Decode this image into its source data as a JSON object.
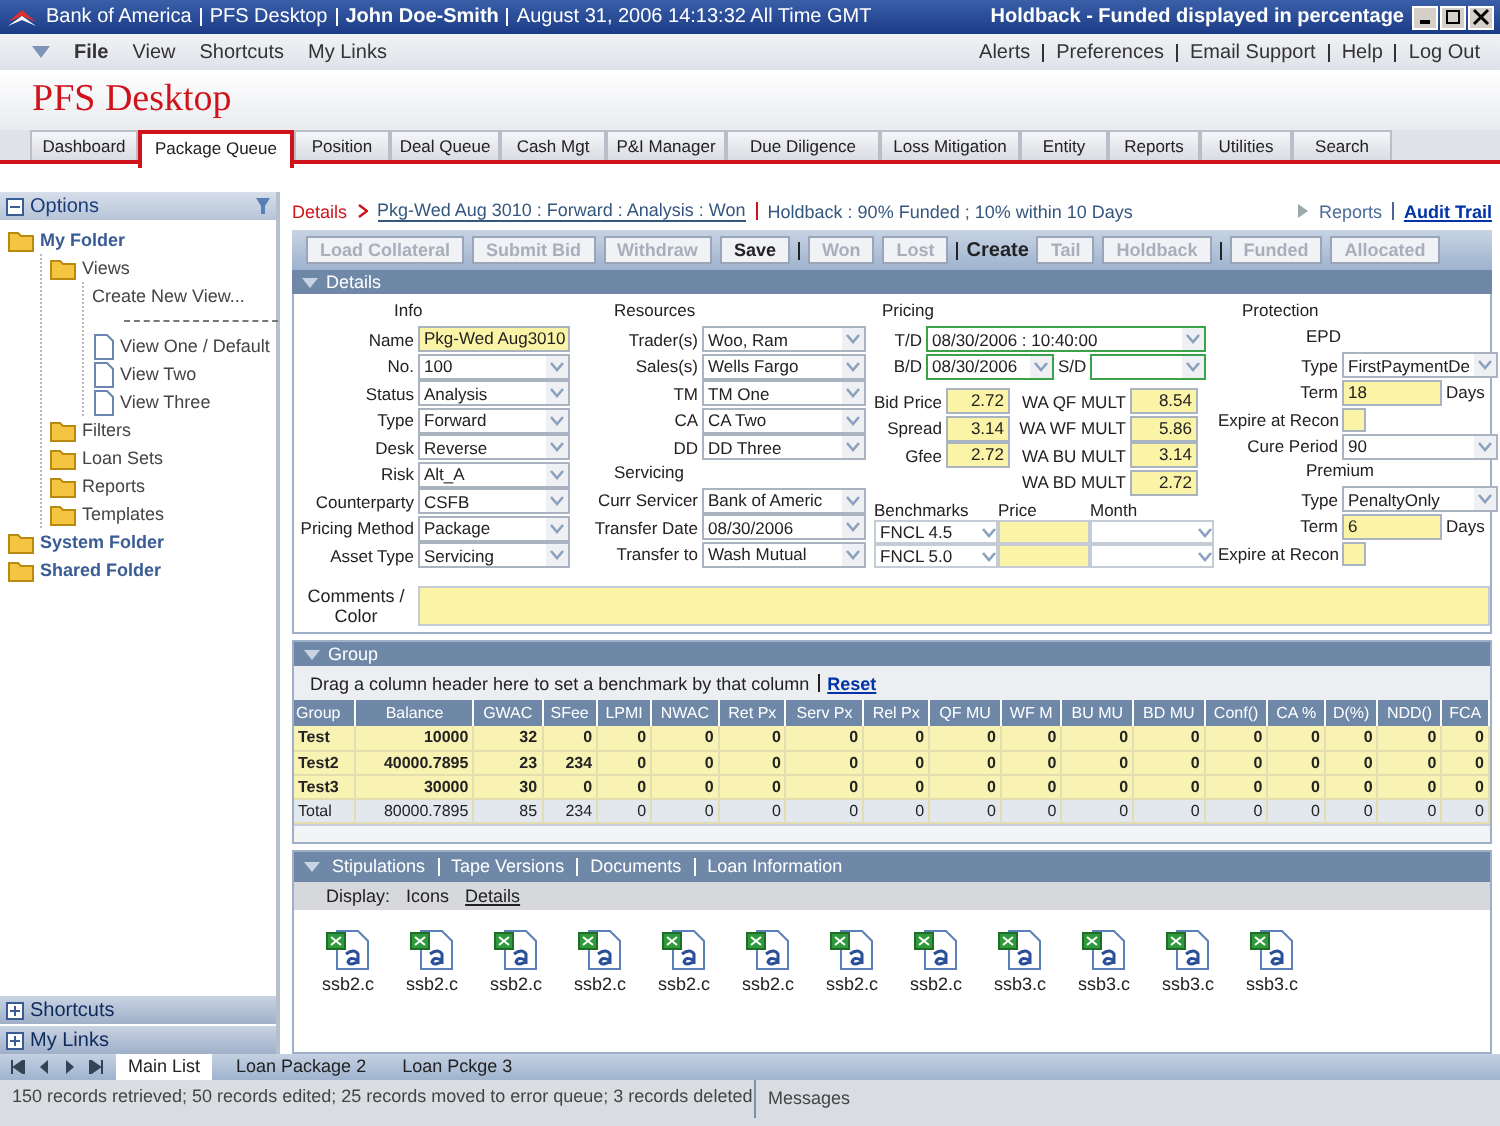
{
  "window": {
    "title_segments": [
      "Bank of America",
      "PFS Desktop",
      "John Doe-Smith",
      "August 31, 2006  14:13:32  All Time GMT"
    ],
    "notice": "Holdback - Funded displayed in percentage"
  },
  "menu": {
    "left": [
      "File",
      "View",
      "Shortcuts",
      "My Links"
    ],
    "right": [
      "Alerts",
      "Preferences",
      "Email Support",
      "Help",
      "Log Out"
    ]
  },
  "app_title": "PFS Desktop",
  "tabs": [
    {
      "label": "Dashboard",
      "selected": false
    },
    {
      "label": "Package Queue",
      "selected": true
    },
    {
      "label": "Position",
      "selected": false
    },
    {
      "label": "Deal Queue",
      "selected": false
    },
    {
      "label": "Cash Mgt",
      "selected": false
    },
    {
      "label": "P&I Manager",
      "selected": false
    },
    {
      "label": "Due Diligence",
      "selected": false
    },
    {
      "label": "Loss Mitigation",
      "selected": false
    },
    {
      "label": "Entity",
      "selected": false
    },
    {
      "label": "Reports",
      "selected": false
    },
    {
      "label": "Utilities",
      "selected": false
    },
    {
      "label": "Search",
      "selected": false
    }
  ],
  "sidebar": {
    "title": "Options",
    "tree": [
      {
        "label": "My Folder",
        "kind": "folder",
        "children": [
          {
            "label": "Views",
            "kind": "folder",
            "children": [
              {
                "label": "Create New View...",
                "kind": "action"
              },
              {
                "kind": "separator"
              },
              {
                "label": "View One / Default",
                "kind": "page"
              },
              {
                "label": "View Two",
                "kind": "page"
              },
              {
                "label": "View Three",
                "kind": "page"
              }
            ]
          },
          {
            "label": "Filters",
            "kind": "folder"
          },
          {
            "label": "Loan Sets",
            "kind": "folder"
          },
          {
            "label": "Reports",
            "kind": "folder"
          },
          {
            "label": "Templates",
            "kind": "folder"
          }
        ]
      },
      {
        "label": "System Folder",
        "kind": "folder"
      },
      {
        "label": "Shared Folder",
        "kind": "folder"
      }
    ],
    "panels": [
      "Shortcuts",
      "My Links"
    ]
  },
  "breadcrumb": {
    "section": "Details",
    "path": "Pkg-Wed Aug 3010 : Forward : Analysis : Won",
    "holdback": "Holdback : 90% Funded ; 10% within 10 Days",
    "links": [
      "Reports",
      "Audit Trail"
    ]
  },
  "toolbar": [
    {
      "kind": "button",
      "label": "Load Collateral",
      "disabled": true
    },
    {
      "kind": "button",
      "label": "Submit Bid",
      "disabled": true
    },
    {
      "kind": "button",
      "label": "Withdraw",
      "disabled": true
    },
    {
      "kind": "button",
      "label": "Save",
      "disabled": false
    },
    {
      "kind": "separator"
    },
    {
      "kind": "button",
      "label": "Won",
      "disabled": true
    },
    {
      "kind": "button",
      "label": "Lost",
      "disabled": true
    },
    {
      "kind": "separator"
    },
    {
      "kind": "label",
      "label": "Create"
    },
    {
      "kind": "button",
      "label": "Tail",
      "disabled": true
    },
    {
      "kind": "button",
      "label": "Holdback",
      "disabled": true
    },
    {
      "kind": "separator"
    },
    {
      "kind": "button",
      "label": "Funded",
      "disabled": true
    },
    {
      "kind": "button",
      "label": "Allocated",
      "disabled": true
    }
  ],
  "details": {
    "title": "Details",
    "info": {
      "heading": "Info",
      "fields": [
        {
          "label": "Name",
          "value": "Pkg-Wed Aug3010",
          "kind": "text"
        },
        {
          "label": "No.",
          "value": "100",
          "kind": "select"
        },
        {
          "label": "Status",
          "value": "Analysis",
          "kind": "select"
        },
        {
          "label": "Type",
          "value": "Forward",
          "kind": "select"
        },
        {
          "label": "Desk",
          "value": "Reverse",
          "kind": "select"
        },
        {
          "label": "Risk",
          "value": "Alt_A",
          "kind": "select"
        },
        {
          "label": "Counterparty",
          "value": "CSFB",
          "kind": "select"
        },
        {
          "label": "Pricing Method",
          "value": "Package",
          "kind": "select"
        },
        {
          "label": "Asset Type",
          "value": "Servicing",
          "kind": "select"
        }
      ]
    },
    "resources": {
      "heading": "Resources",
      "fields": [
        {
          "label": "Trader(s)",
          "value": "Woo, Ram",
          "kind": "select"
        },
        {
          "label": "Sales(s)",
          "value": "Wells Fargo",
          "kind": "select"
        },
        {
          "label": "TM",
          "value": "TM One",
          "kind": "select"
        },
        {
          "label": "CA",
          "value": "CA Two",
          "kind": "select"
        },
        {
          "label": "DD",
          "value": "DD Three",
          "kind": "select"
        }
      ]
    },
    "servicing": {
      "heading": "Servicing",
      "fields": [
        {
          "label": "Curr Servicer",
          "value": "Bank of Americ",
          "kind": "select"
        },
        {
          "label": "Transfer Date",
          "value": "08/30/2006",
          "kind": "select"
        },
        {
          "label": "Transfer to",
          "value": "Wash Mutual",
          "kind": "select"
        }
      ]
    },
    "pricing": {
      "heading": "Pricing",
      "td_label": "T/D",
      "td_value": "08/30/2006 : 10:40:00",
      "bd_label": "B/D",
      "bd_value": "08/30/2006",
      "sd_label": "S/D",
      "prices": [
        {
          "label": "Bid Price",
          "value": "2.72"
        },
        {
          "label": "Spread",
          "value": "3.14"
        },
        {
          "label": "Gfee",
          "value": "2.72"
        }
      ],
      "multiples": [
        {
          "label": "WA QF MULT",
          "value": "8.54"
        },
        {
          "label": "WA WF MULT",
          "value": "5.86"
        },
        {
          "label": "WA BU MULT",
          "value": "3.14"
        },
        {
          "label": "WA BD MULT",
          "value": "2.72"
        }
      ],
      "benchmark_columns": [
        "Benchmarks",
        "Price",
        "Month"
      ],
      "benchmarks": [
        "FNCL 4.5",
        "FNCL 5.0"
      ]
    },
    "protection": {
      "heading": "Protection",
      "groups": [
        {
          "heading": "EPD",
          "fields": [
            {
              "label": "Type",
              "value": "FirstPaymentDe",
              "kind": "select"
            },
            {
              "label": "Term",
              "value": "18",
              "kind": "days",
              "unit": "Days"
            },
            {
              "label": "Expire at Recon",
              "kind": "flag"
            },
            {
              "label": "Cure Period",
              "value": "90",
              "kind": "select"
            }
          ]
        },
        {
          "heading": "Premium",
          "fields": [
            {
              "label": "Type",
              "value": "PenaltyOnly",
              "kind": "select"
            },
            {
              "label": "Term",
              "value": "6",
              "kind": "days",
              "unit": "Days"
            },
            {
              "label": "Expire at Recon",
              "kind": "flag"
            }
          ]
        }
      ]
    },
    "comments_label": "Comments / Color"
  },
  "group": {
    "title": "Group",
    "hint": "Drag a column header here to set a benchmark by that column",
    "reset": "Reset",
    "columns": [
      "Group",
      "Balance",
      "GWAC",
      "SFee",
      "LPMI",
      "NWAC",
      "Ret Px",
      "Serv Px",
      "Rel Px",
      "QF MU",
      "WF M",
      "BU MU",
      "BD MU",
      "Conf()",
      "CA %",
      "D(%)",
      "NDD()",
      "FCA"
    ],
    "rows": [
      {
        "kind": "data",
        "cells": [
          "Test",
          "10000",
          "32",
          "0",
          "0",
          "0",
          "0",
          "0",
          "0",
          "0",
          "0",
          "0",
          "0",
          "0",
          "0",
          "0",
          "0",
          "0"
        ]
      },
      {
        "kind": "data",
        "cells": [
          "Test2",
          "40000.7895",
          "23",
          "234",
          "0",
          "0",
          "0",
          "0",
          "0",
          "0",
          "0",
          "0",
          "0",
          "0",
          "0",
          "0",
          "0",
          "0"
        ]
      },
      {
        "kind": "data",
        "cells": [
          "Test3",
          "30000",
          "30",
          "0",
          "0",
          "0",
          "0",
          "0",
          "0",
          "0",
          "0",
          "0",
          "0",
          "0",
          "0",
          "0",
          "0",
          "0"
        ]
      },
      {
        "kind": "total",
        "cells": [
          "Total",
          "80000.7895",
          "85",
          "234",
          "0",
          "0",
          "0",
          "0",
          "0",
          "0",
          "0",
          "0",
          "0",
          "0",
          "0",
          "0",
          "0",
          "0"
        ]
      }
    ]
  },
  "attachments": {
    "tabs": [
      "Stipulations",
      "Tape Versions",
      "Documents",
      "Loan Information"
    ],
    "display_label": "Display:",
    "display_options": [
      {
        "label": "Icons",
        "selected": false
      },
      {
        "label": "Details",
        "selected": true
      }
    ],
    "files": [
      "ssb2.c",
      "ssb2.c",
      "ssb2.c",
      "ssb2.c",
      "ssb2.c",
      "ssb2.c",
      "ssb2.c",
      "ssb2.c",
      "ssb3.c",
      "ssb3.c",
      "ssb3.c",
      "ssb3.c"
    ]
  },
  "sheet_tabs": [
    {
      "label": "Main List",
      "selected": true
    },
    {
      "label": "Loan Package 2",
      "selected": false
    },
    {
      "label": "Loan Pckge 3",
      "selected": false
    }
  ],
  "status_bar": {
    "records": "150 records retrieved; 50 records edited; 25 records moved to error queue; 3 records deleted",
    "messages": "Messages"
  }
}
